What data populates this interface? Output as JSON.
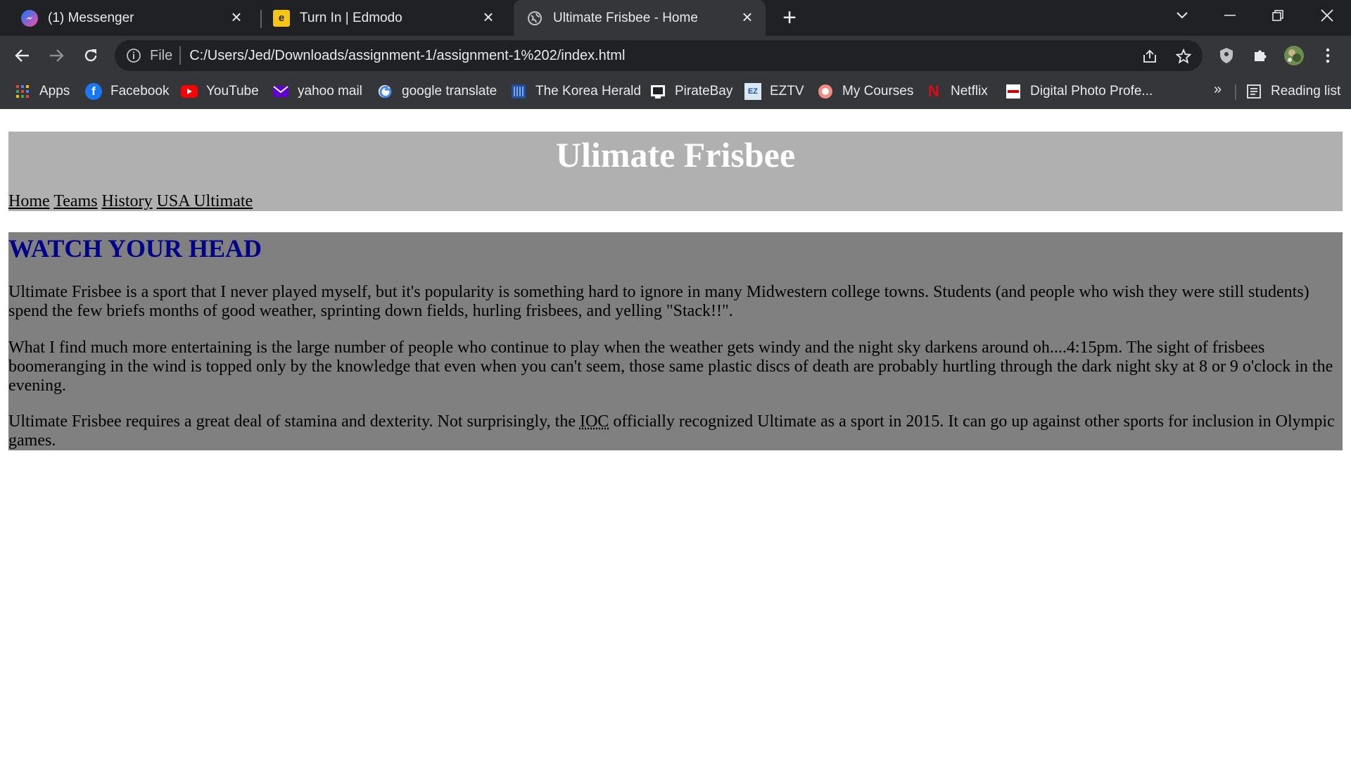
{
  "browser": {
    "tabs": [
      {
        "title": "(1) Messenger",
        "icon": "messenger-icon"
      },
      {
        "title": "Turn In | Edmodo",
        "icon": "edmodo-icon"
      },
      {
        "title": "Ultimate Frisbee - Home",
        "icon": "globe-icon"
      }
    ],
    "address": {
      "scheme": "File",
      "url": "C:/Users/Jed/Downloads/assignment-1/assignment-1%202/index.html"
    },
    "bookmarks": [
      {
        "label": "Apps",
        "icon": "apps-grid-icon"
      },
      {
        "label": "Facebook",
        "icon": "facebook-icon"
      },
      {
        "label": "YouTube",
        "icon": "youtube-icon"
      },
      {
        "label": "yahoo mail",
        "icon": "yahoo-mail-icon"
      },
      {
        "label": "google translate",
        "icon": "google-icon"
      },
      {
        "label": "The Korea Herald",
        "icon": "korea-herald-icon"
      },
      {
        "label": "PirateBay",
        "icon": "piratebay-icon"
      },
      {
        "label": "EZTV",
        "icon": "eztv-icon"
      },
      {
        "label": "My Courses",
        "icon": "my-courses-icon"
      },
      {
        "label": "Netflix",
        "icon": "netflix-icon"
      },
      {
        "label": "Digital Photo Profe...",
        "icon": "canon-icon"
      }
    ],
    "overflow": "»",
    "reading_list": "Reading list",
    "colors": {
      "frame": "#202124",
      "toolbar": "#35363a",
      "text": "#e8eaed"
    }
  },
  "page": {
    "title": "Ulimate Frisbee",
    "nav": [
      "Home",
      "Teams",
      "History",
      "USA Ultimate"
    ],
    "heading": "WATCH YOUR HEAD",
    "paragraphs": [
      "Ultimate Frisbee is a sport that I never played myself, but it's popularity is something hard to ignore in many Midwestern college towns. Students (and people who wish they were still students) spend the few briefs months of good weather, sprinting down fields, hurling frisbees, and yelling \"Stack!!\".",
      "What I find much more entertaining is the large number of people who continue to play when the weather gets windy and the night sky darkens around oh....4:15pm. The sight of frisbees boomeranging in the wind is topped only by the knowledge that even when you can't seem, those same plastic discs of death are probably hurtling through the dark night sky at 8 or 9 o'clock in the evening."
    ],
    "p3": {
      "before": "Ultimate Frisbee requires a great deal of stamina and dexterity. Not surprisingly, the ",
      "abbr": "IOC",
      "after": " officially recognized Ultimate as a sport in 2015. It can go up against other sports for inclusion in Olympic games."
    },
    "colors": {
      "header_bg": "#b0b0b0",
      "main_bg": "#808080",
      "heading": "#00008b",
      "title": "#ffffff"
    }
  }
}
